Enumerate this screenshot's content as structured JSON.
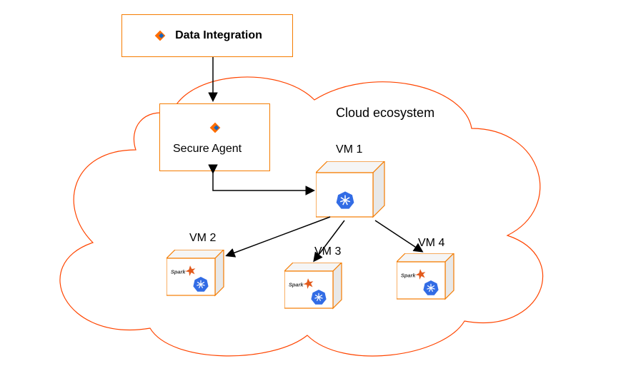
{
  "header": {
    "title": "Data Integration"
  },
  "cloud": {
    "title": "Cloud ecosystem"
  },
  "secure_agent": {
    "label": "Secure Agent"
  },
  "vms": {
    "vm1": {
      "label": "VM 1"
    },
    "vm2": {
      "label": "VM 2"
    },
    "vm3": {
      "label": "VM 3"
    },
    "vm4": {
      "label": "VM 4"
    }
  },
  "icons": {
    "informatica": "informatica-logo",
    "kubernetes": "kubernetes-logo",
    "spark": "apache-spark-logo"
  },
  "colors": {
    "box_border": "#f57c00",
    "cloud_border": "#ff4500",
    "arrow": "#000000",
    "k8s_blue": "#326ce5",
    "informatica_orange": "#ff6d00",
    "spark_orange": "#e25a1c"
  }
}
